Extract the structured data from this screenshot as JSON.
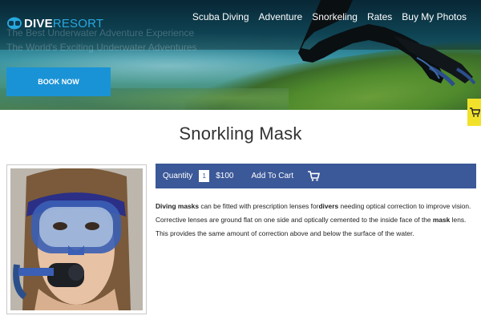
{
  "header": {
    "logo_primary": "DIVE",
    "logo_secondary": "RESORT",
    "nav": [
      "Scuba Diving",
      "Adventure",
      "Snorkeling",
      "Rates",
      "Buy My Photos"
    ],
    "hero_line1": "The Best Underwater Adventure Experience",
    "hero_line2": "The World's Exciting Underwater Adventures",
    "cta_label": "BOOK NOW"
  },
  "product": {
    "title": "Snorkling Mask",
    "quantity_label": "Quantity",
    "quantity_value": "1",
    "price": "$100",
    "add_to_cart_label": "Add To Cart"
  },
  "description": {
    "line1": {
      "bold1": "Diving masks",
      "text1": " can be fitted with prescription lenses for",
      "bold2": "divers",
      "text2": " needing optical correction to improve vision."
    },
    "line2": {
      "text1": "Corrective lenses are ground flat on one side and optically cemented to the inside face of the ",
      "bold1": "mask",
      "text2": " lens."
    },
    "line3": "This provides the same amount of correction above and below the surface of the water."
  },
  "icons": {
    "logo": "diver-mask-icon",
    "cart_bar": "shopping-cart-icon",
    "cart_tab": "shopping-cart-icon"
  },
  "colors": {
    "accent": "#1a93d6",
    "logo_secondary": "#29a8e0",
    "purchase_bar": "#3b5898",
    "cart_tab": "#f2e12a"
  }
}
